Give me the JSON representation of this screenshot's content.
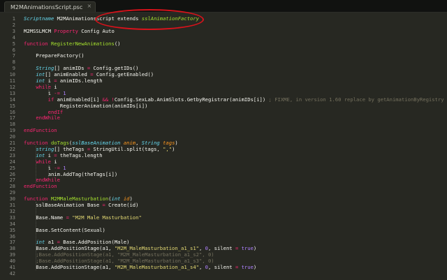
{
  "tab": {
    "title": "M2MAnimationsScript.psc",
    "close": "×"
  },
  "colors": {
    "background": "#272822",
    "keyword": "#f92672",
    "function": "#a6e22e",
    "type": "#66d9ef",
    "string": "#e6db74",
    "number": "#ae81ff",
    "comment": "#75715e",
    "highlight": "#d8121b"
  },
  "lines": [
    {
      "n": "1",
      "tokens": [
        {
          "t": "Scriptname",
          "k": "ty"
        },
        {
          "t": " M2MAnimationsScript ",
          "k": "tx"
        },
        {
          "t": "extends ",
          "k": "tx"
        },
        {
          "t": "sslAnimationFactory",
          "k": "cl"
        }
      ]
    },
    {
      "n": "2",
      "tokens": []
    },
    {
      "n": "3",
      "tokens": [
        {
          "t": "M2MSSLMCM ",
          "k": "tx"
        },
        {
          "t": "Property",
          "k": "kw"
        },
        {
          "t": " Config Auto",
          "k": "tx"
        }
      ]
    },
    {
      "n": "4",
      "tokens": []
    },
    {
      "n": "5",
      "tokens": [
        {
          "t": "function",
          "k": "kw"
        },
        {
          "t": " ",
          "k": "tx"
        },
        {
          "t": "RegisterNewAnimations",
          "k": "fn"
        },
        {
          "t": "()",
          "k": "tx"
        }
      ]
    },
    {
      "n": "6",
      "tokens": []
    },
    {
      "n": "7",
      "tokens": [
        {
          "t": "    PrepareFactory()",
          "k": "tx"
        }
      ]
    },
    {
      "n": "8",
      "tokens": []
    },
    {
      "n": "9",
      "tokens": [
        {
          "t": "    ",
          "k": "tx"
        },
        {
          "t": "String",
          "k": "ty"
        },
        {
          "t": "[] animIDs ",
          "k": "tx"
        },
        {
          "t": "=",
          "k": "kw"
        },
        {
          "t": " Config.getIDs()",
          "k": "tx"
        }
      ]
    },
    {
      "n": "10",
      "tokens": [
        {
          "t": "    ",
          "k": "tx"
        },
        {
          "t": "int",
          "k": "ty"
        },
        {
          "t": "[] animEnabled ",
          "k": "tx"
        },
        {
          "t": "=",
          "k": "kw"
        },
        {
          "t": " Config.getEnabled()",
          "k": "tx"
        }
      ]
    },
    {
      "n": "11",
      "tokens": [
        {
          "t": "    ",
          "k": "tx"
        },
        {
          "t": "int",
          "k": "ty"
        },
        {
          "t": " i ",
          "k": "tx"
        },
        {
          "t": "=",
          "k": "kw"
        },
        {
          "t": " animIDs.length",
          "k": "tx"
        }
      ]
    },
    {
      "n": "12",
      "tokens": [
        {
          "t": "    ",
          "k": "tx"
        },
        {
          "t": "while",
          "k": "kw"
        },
        {
          "t": " i",
          "k": "tx"
        }
      ]
    },
    {
      "n": "13",
      "tokens": [
        {
          "t": "        i ",
          "k": "tx"
        },
        {
          "t": "-=",
          "k": "kw"
        },
        {
          "t": " ",
          "k": "tx"
        },
        {
          "t": "1",
          "k": "nu"
        }
      ]
    },
    {
      "n": "14",
      "tokens": [
        {
          "t": "        ",
          "k": "tx"
        },
        {
          "t": "if",
          "k": "kw"
        },
        {
          "t": " animEnabled[i] ",
          "k": "tx"
        },
        {
          "t": "&&",
          "k": "kw"
        },
        {
          "t": " ",
          "k": "tx"
        },
        {
          "t": "!",
          "k": "kw"
        },
        {
          "t": "Config.SexLab.AnimSlots.GetbyRegistrar(animIDs[i]) ",
          "k": "tx"
        },
        {
          "t": "; FIXME, in version 1.60 replace by getAnimationByRegistry",
          "k": "cm"
        }
      ]
    },
    {
      "n": "15",
      "tokens": [
        {
          "t": "            RegisterAnimation(animIDs[i])",
          "k": "tx"
        }
      ]
    },
    {
      "n": "16",
      "tokens": [
        {
          "t": "        ",
          "k": "tx"
        },
        {
          "t": "endIf",
          "k": "kw"
        }
      ]
    },
    {
      "n": "17",
      "tokens": [
        {
          "t": "    ",
          "k": "tx"
        },
        {
          "t": "endWhile",
          "k": "kw"
        }
      ]
    },
    {
      "n": "18",
      "tokens": []
    },
    {
      "n": "19",
      "tokens": [
        {
          "t": "endFunction",
          "k": "kw"
        }
      ]
    },
    {
      "n": "20",
      "tokens": []
    },
    {
      "n": "21",
      "tokens": [
        {
          "t": "function",
          "k": "kw"
        },
        {
          "t": " ",
          "k": "tx"
        },
        {
          "t": "doTags",
          "k": "fn"
        },
        {
          "t": "(",
          "k": "tx"
        },
        {
          "t": "sslBaseAnimation",
          "k": "ty"
        },
        {
          "t": " ",
          "k": "tx"
        },
        {
          "t": "anim",
          "k": "pa"
        },
        {
          "t": ", ",
          "k": "tx"
        },
        {
          "t": "String",
          "k": "ty"
        },
        {
          "t": " ",
          "k": "tx"
        },
        {
          "t": "tags",
          "k": "pa"
        },
        {
          "t": ")",
          "k": "tx"
        }
      ]
    },
    {
      "n": "22",
      "tokens": [
        {
          "t": "    ",
          "k": "tx"
        },
        {
          "t": "string",
          "k": "ty"
        },
        {
          "t": "[] theTags ",
          "k": "tx"
        },
        {
          "t": "=",
          "k": "kw"
        },
        {
          "t": " StringUtil.split(tags, ",
          "k": "tx"
        },
        {
          "t": "\",\"",
          "k": "st"
        },
        {
          "t": ")",
          "k": "tx"
        }
      ]
    },
    {
      "n": "23",
      "tokens": [
        {
          "t": "    ",
          "k": "tx"
        },
        {
          "t": "int",
          "k": "ty"
        },
        {
          "t": " i ",
          "k": "tx"
        },
        {
          "t": "=",
          "k": "kw"
        },
        {
          "t": " theTags.length",
          "k": "tx"
        }
      ]
    },
    {
      "n": "24",
      "tokens": [
        {
          "t": "    ",
          "k": "tx"
        },
        {
          "t": "while",
          "k": "kw"
        },
        {
          "t": " i",
          "k": "tx"
        }
      ]
    },
    {
      "n": "25",
      "tokens": [
        {
          "t": "        i ",
          "k": "tx"
        },
        {
          "t": "-=",
          "k": "kw"
        },
        {
          "t": " ",
          "k": "tx"
        },
        {
          "t": "1",
          "k": "nu"
        }
      ]
    },
    {
      "n": "26",
      "tokens": [
        {
          "t": "        anim.AddTag(theTags[i])",
          "k": "tx"
        }
      ]
    },
    {
      "n": "27",
      "tokens": [
        {
          "t": "    ",
          "k": "tx"
        },
        {
          "t": "endWhile",
          "k": "kw"
        }
      ]
    },
    {
      "n": "28",
      "tokens": [
        {
          "t": "endFunction",
          "k": "kw"
        }
      ]
    },
    {
      "n": "29",
      "tokens": []
    },
    {
      "n": "30",
      "tokens": [
        {
          "t": "function",
          "k": "kw"
        },
        {
          "t": " ",
          "k": "tx"
        },
        {
          "t": "M2MMaleMasturbation",
          "k": "fn"
        },
        {
          "t": "(",
          "k": "tx"
        },
        {
          "t": "int",
          "k": "ty"
        },
        {
          "t": " ",
          "k": "tx"
        },
        {
          "t": "id",
          "k": "pa"
        },
        {
          "t": ")",
          "k": "tx"
        }
      ]
    },
    {
      "n": "31",
      "tokens": [
        {
          "t": "    sslBaseAnimation Base ",
          "k": "tx"
        },
        {
          "t": "=",
          "k": "kw"
        },
        {
          "t": " Create(id)",
          "k": "tx"
        }
      ]
    },
    {
      "n": "32",
      "tokens": []
    },
    {
      "n": "33",
      "tokens": [
        {
          "t": "    Base.Name ",
          "k": "tx"
        },
        {
          "t": "=",
          "k": "kw"
        },
        {
          "t": " ",
          "k": "tx"
        },
        {
          "t": "\"M2M Male Masturbation\"",
          "k": "st"
        }
      ]
    },
    {
      "n": "34",
      "tokens": []
    },
    {
      "n": "35",
      "tokens": [
        {
          "t": "    Base.SetContent(Sexual)",
          "k": "tx"
        }
      ]
    },
    {
      "n": "36",
      "tokens": []
    },
    {
      "n": "37",
      "tokens": [
        {
          "t": "    ",
          "k": "tx"
        },
        {
          "t": "int",
          "k": "ty"
        },
        {
          "t": " a1 ",
          "k": "tx"
        },
        {
          "t": "=",
          "k": "kw"
        },
        {
          "t": " Base.AddPosition(Male)",
          "k": "tx"
        }
      ]
    },
    {
      "n": "38",
      "tokens": [
        {
          "t": "    Base.AddPositionStage(a1, ",
          "k": "tx"
        },
        {
          "t": "\"M2M_MaleMasturbation_a1_s1\"",
          "k": "st"
        },
        {
          "t": ", ",
          "k": "tx"
        },
        {
          "t": "0",
          "k": "nu"
        },
        {
          "t": ", silent ",
          "k": "tx"
        },
        {
          "t": "=",
          "k": "kw"
        },
        {
          "t": " ",
          "k": "tx"
        },
        {
          "t": "true",
          "k": "nu"
        },
        {
          "t": ")",
          "k": "tx"
        }
      ]
    },
    {
      "n": "39",
      "tokens": [
        {
          "t": "    ;Base.AddPositionStage(a1, \"M2M_MaleMasturbation_a1_s2\", 0)",
          "k": "cm"
        }
      ]
    },
    {
      "n": "40",
      "tokens": [
        {
          "t": "    ;Base.AddPositionStage(a1, \"M2M_MaleMasturbation_a1_s3\", 0)",
          "k": "cm"
        }
      ]
    },
    {
      "n": "41",
      "tokens": [
        {
          "t": "    Base.AddPositionStage(a1, ",
          "k": "tx"
        },
        {
          "t": "\"M2M_MaleMasturbation_a1_s4\"",
          "k": "st"
        },
        {
          "t": ", ",
          "k": "tx"
        },
        {
          "t": "0",
          "k": "nu"
        },
        {
          "t": ", silent ",
          "k": "tx"
        },
        {
          "t": "=",
          "k": "kw"
        },
        {
          "t": " ",
          "k": "tx"
        },
        {
          "t": "true",
          "k": "nu"
        },
        {
          "t": ")",
          "k": "tx"
        }
      ]
    },
    {
      "n": "42",
      "tokens": []
    }
  ]
}
